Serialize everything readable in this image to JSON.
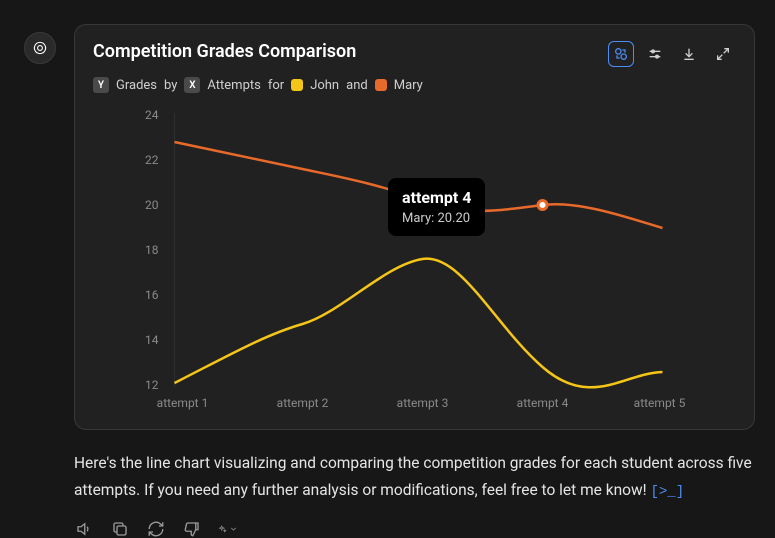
{
  "card": {
    "title": "Competition Grades Comparison",
    "legend": {
      "y_badge": "Y",
      "y_text": "Grades",
      "by": "by",
      "x_badge": "X",
      "x_text": "Attempts",
      "for": "for",
      "series1": "John",
      "and": "and",
      "series2": "Mary"
    }
  },
  "chart_data": {
    "type": "line",
    "title": "Competition Grades Comparison",
    "xlabel": "Attempts",
    "ylabel": "Grades",
    "categories": [
      "attempt 1",
      "attempt 2",
      "attempt 3",
      "attempt 4",
      "attempt 5"
    ],
    "series": [
      {
        "name": "John",
        "color": "#f5c518",
        "values": [
          12.1,
          14.7,
          17.6,
          12.8,
          12.6
        ]
      },
      {
        "name": "Mary",
        "color": "#e86a2a",
        "values": [
          22.8,
          21.6,
          20.9,
          20.2,
          19.0
        ]
      }
    ],
    "ylim": [
      12,
      24
    ],
    "yticks": [
      12,
      14,
      16,
      18,
      20,
      22,
      24
    ],
    "tooltip": {
      "category": "attempt 4",
      "series": "Mary",
      "value_text": "Mary: 20.20"
    }
  },
  "description": "Here's the line chart visualizing and comparing the competition grades for each student across five attempts. If you need any further analysis or modifications, feel free to let me know!",
  "code_link": "[>_]",
  "icons": {
    "toolbar": [
      "color-switch-icon",
      "sliders-icon",
      "download-icon",
      "expand-icon"
    ],
    "actions": [
      "audio-icon",
      "copy-icon",
      "regenerate-icon",
      "thumbs-down-icon",
      "sparkle-icon"
    ]
  }
}
